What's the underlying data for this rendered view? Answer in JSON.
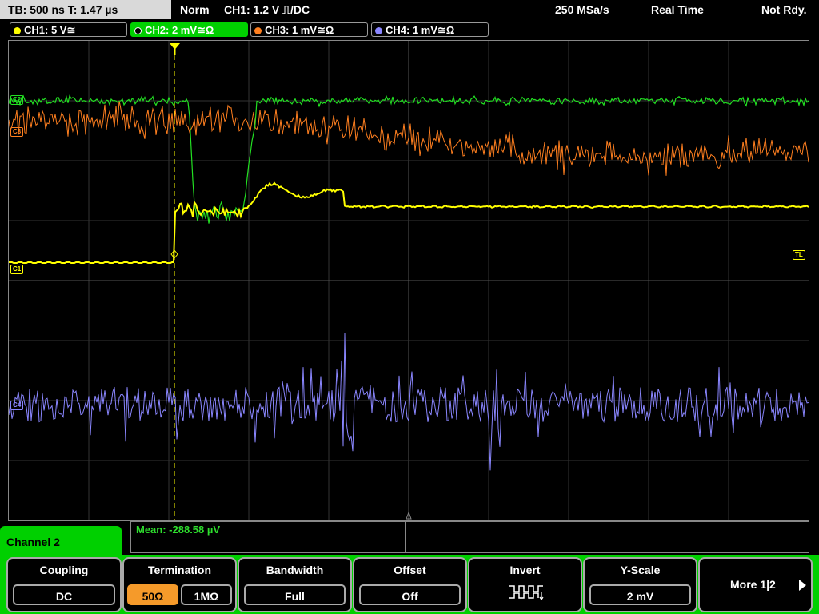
{
  "status": {
    "timebase": "TB: 500 ns   T: 1.47 µs",
    "mode": "Norm",
    "trigger": "CH1: 1.2 V ⎍/DC",
    "sample_rate": "250 MSa/s",
    "acq": "Real Time",
    "ready": "Not Rdy."
  },
  "channels": [
    {
      "label": "CH1: 5 V≅",
      "color": "#ffff00",
      "active": false
    },
    {
      "label": "CH2: 2 mV≅Ω",
      "color": "#22e022",
      "active": true
    },
    {
      "label": "CH3: 1 mV≅Ω",
      "color": "#ff7f1f",
      "active": false
    },
    {
      "label": "CH4: 1 mV≅Ω",
      "color": "#8a86ff",
      "active": false
    }
  ],
  "markers": {
    "c2": "C2",
    "c3": "C3",
    "c1": "C1",
    "c4": "C4",
    "tl": "TL",
    "trigger": "T"
  },
  "measurement": {
    "mean": "Mean: -288.58 µV"
  },
  "menu": {
    "channel_label": "Channel 2",
    "coupling": {
      "title": "Coupling",
      "value": "DC"
    },
    "termination": {
      "title": "Termination",
      "options": [
        "50Ω",
        "1MΩ"
      ],
      "selected": "50Ω"
    },
    "bandwidth": {
      "title": "Bandwidth",
      "value": "Full"
    },
    "offset": {
      "title": "Offset",
      "value": "Off"
    },
    "invert": {
      "title": "Invert",
      "icon": "invert-waveform-icon"
    },
    "yscale": {
      "title": "Y-Scale",
      "value": "2 mV"
    },
    "more": {
      "label": "More 1|2"
    }
  },
  "colors": {
    "ch1": "#ffff00",
    "ch2": "#22e022",
    "ch3": "#ff7f1f",
    "ch4": "#8a86ff",
    "menu_accent": "#00d000",
    "active_option": "#f59a2a"
  }
}
